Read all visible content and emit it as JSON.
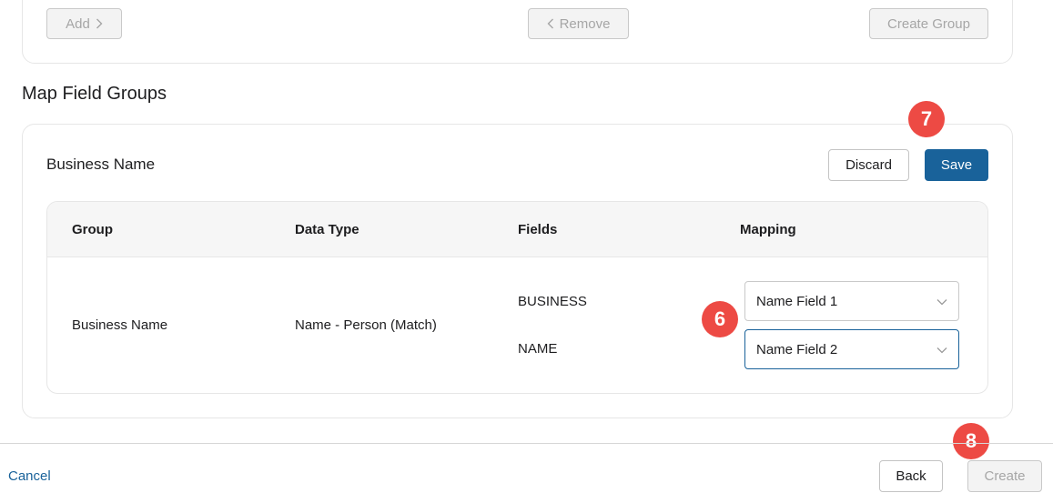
{
  "top_toolbar": {
    "add_label": "Add",
    "remove_label": "Remove",
    "create_group_label": "Create Group"
  },
  "section": {
    "title": "Map Field Groups"
  },
  "group_card": {
    "title": "Business Name",
    "discard_label": "Discard",
    "save_label": "Save"
  },
  "table": {
    "headers": [
      "Group",
      "Data Type",
      "Fields",
      "Mapping"
    ],
    "row": {
      "group": "Business Name",
      "data_type": "Name - Person (Match)",
      "fields": [
        "BUSINESS",
        "NAME"
      ],
      "mappings": [
        "Name Field 1",
        "Name Field 2"
      ]
    }
  },
  "annotations": {
    "six": "6",
    "seven": "7",
    "eight": "8"
  },
  "footer": {
    "cancel_label": "Cancel",
    "back_label": "Back",
    "create_label": "Create"
  },
  "colors": {
    "primary": "#19629a",
    "badge": "#ed4a44"
  }
}
